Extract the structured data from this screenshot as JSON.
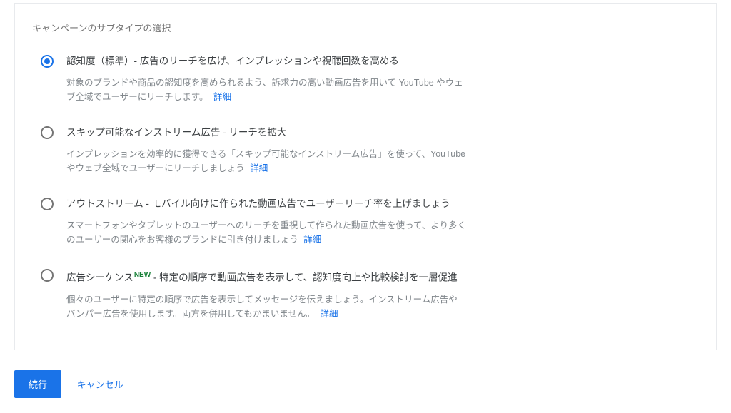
{
  "section_title": "キャンペーンのサブタイプの選択",
  "options": [
    {
      "title": "認知度（標準）- 広告のリーチを広げ、インプレッションや視聴回数を高める",
      "desc": "対象のブランドや商品の認知度を高められるよう、訴求力の高い動画広告を用いて YouTube やウェブ全域でユーザーにリーチします。",
      "link": "詳細",
      "selected": true,
      "badge": ""
    },
    {
      "title": "スキップ可能なインストリーム広告 - リーチを拡大",
      "desc": "インプレッションを効率的に獲得できる「スキップ可能なインストリーム広告」を使って、YouTube やウェブ全域でユーザーにリーチしましょう",
      "link": "詳細",
      "selected": false,
      "badge": ""
    },
    {
      "title": "アウトストリーム - モバイル向けに作られた動画広告でユーザーリーチ率を上げましょう",
      "desc": "スマートフォンやタブレットのユーザーへのリーチを重視して作られた動画広告を使って、より多くのユーザーの関心をお客様のブランドに引き付けましょう",
      "link": "詳細",
      "selected": false,
      "badge": ""
    },
    {
      "title_pre": "広告シーケンス",
      "title_post": " - 特定の順序で動画広告を表示して、認知度向上や比較検討を一層促進",
      "desc": "個々のユーザーに特定の順序で広告を表示してメッセージを伝えましょう。インストリーム広告やバンパー広告を使用します。両方を併用してもかまいません。",
      "link": "詳細",
      "selected": false,
      "badge": "NEW"
    }
  ],
  "footer": {
    "continue": "続行",
    "cancel": "キャンセル"
  }
}
